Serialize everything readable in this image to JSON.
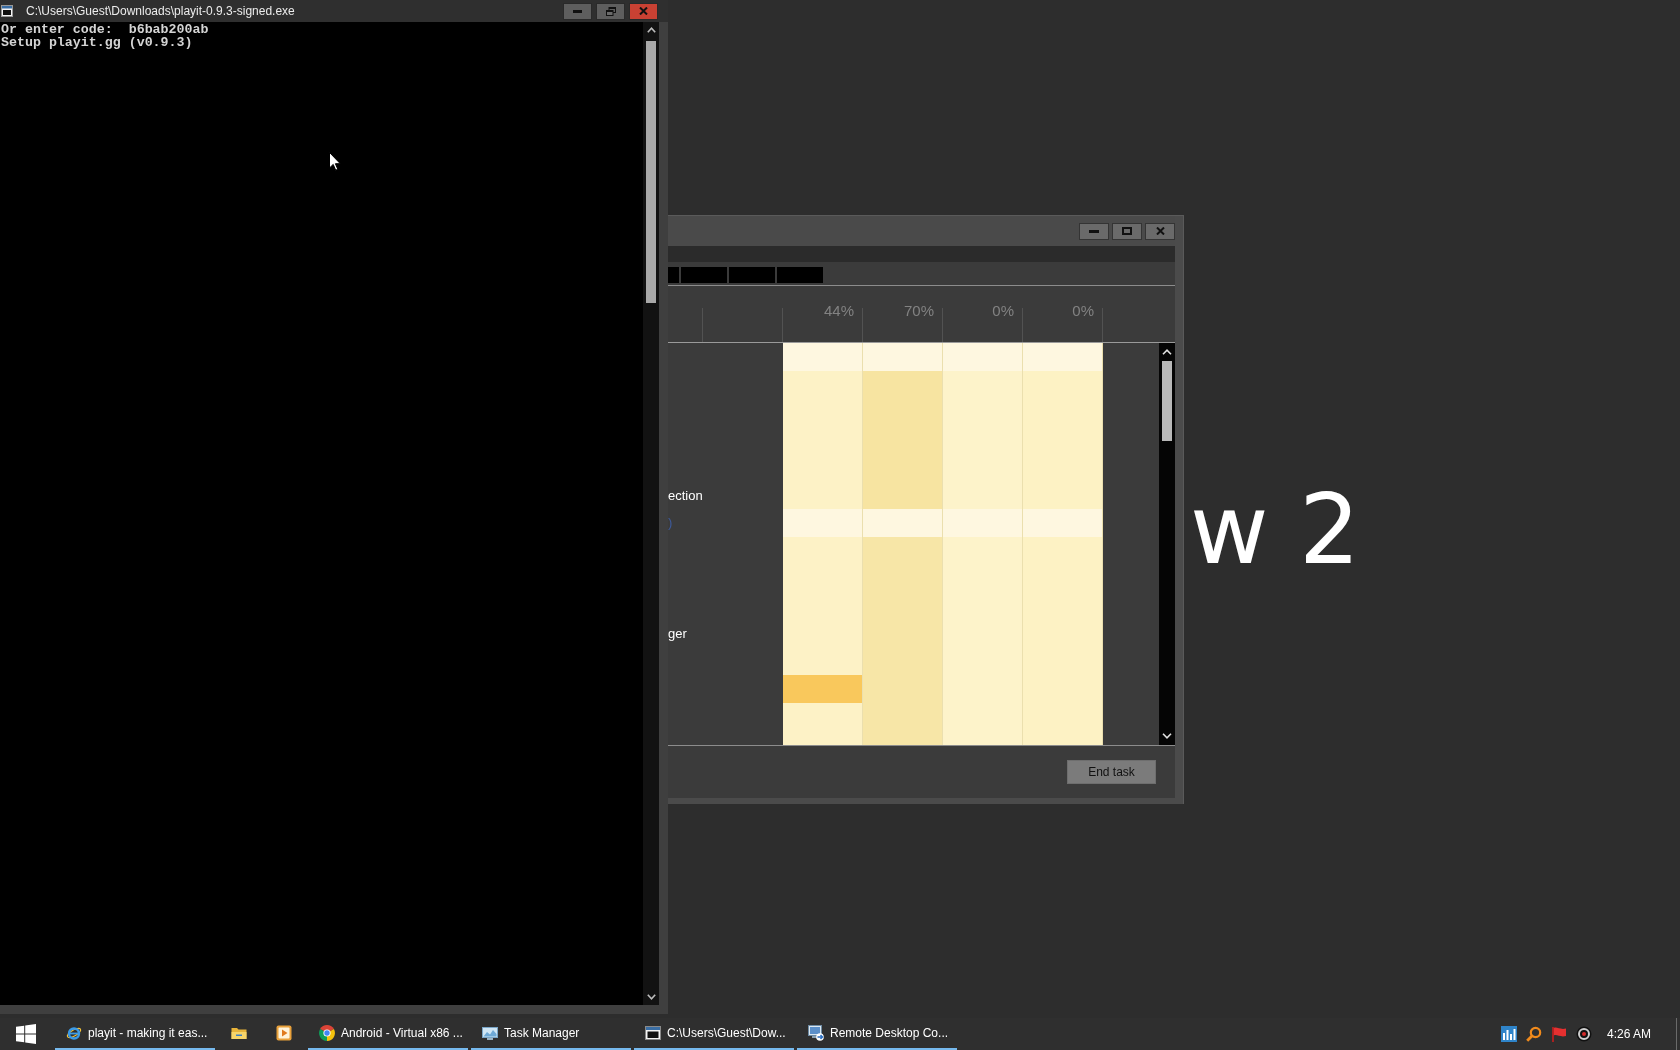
{
  "desktop": {
    "wallpaper_text": "w 2"
  },
  "console_window": {
    "title": "C:\\Users\\Guest\\Downloads\\playit-0.9.3-signed.exe",
    "lines": [
      "Or enter code:  b6bab200ab",
      "Setup playit.gg (v0.9.3)"
    ]
  },
  "task_manager": {
    "tabs": [
      {
        "kind": "cut"
      },
      {
        "kind": "full"
      },
      {
        "kind": "full"
      },
      {
        "kind": "full"
      }
    ],
    "columns": [
      {
        "heading": "44%"
      },
      {
        "heading": "70%"
      },
      {
        "heading": "0%"
      },
      {
        "heading": "0%"
      }
    ],
    "rows": [
      {
        "cells": [
          {
            "color": "#fef7e0"
          },
          {
            "color": "#fef7e0"
          },
          {
            "color": "#fef7e0"
          },
          {
            "color": "#fef7e0"
          }
        ]
      },
      {
        "cells": [
          {
            "color": "#fdf2c6"
          },
          {
            "color": "#f7e4a1"
          },
          {
            "color": "#fdf3ca"
          },
          {
            "color": "#fdf2c4"
          }
        ]
      },
      {
        "cells": [
          {
            "color": "#fdf2c6"
          },
          {
            "color": "#f7e4a1"
          },
          {
            "color": "#fdf3ca"
          },
          {
            "color": "#fdf2c4"
          }
        ]
      },
      {
        "cells": [
          {
            "color": "#fdf2c6"
          },
          {
            "color": "#f7e4a1"
          },
          {
            "color": "#fdf3ca"
          },
          {
            "color": "#fdf2c4"
          }
        ]
      },
      {
        "cells": [
          {
            "color": "#fdf2c6"
          },
          {
            "color": "#f7e4a1"
          },
          {
            "color": "#fdf3ca"
          },
          {
            "color": "#fdf2c4"
          }
        ]
      },
      {
        "label": "ection",
        "cells": [
          {
            "color": "#fdf2c6"
          },
          {
            "color": "#f7e4a1"
          },
          {
            "color": "#fdf3ca"
          },
          {
            "color": "#fdf2c4"
          }
        ]
      },
      {
        "count": ")",
        "cells": [
          {
            "color": "#fef7e0"
          },
          {
            "color": "#fef7e0"
          },
          {
            "color": "#fef7e0"
          },
          {
            "color": "#fef7e0"
          }
        ]
      },
      {
        "cells": [
          {
            "color": "#fdf2c6"
          },
          {
            "color": "#f7e6a7"
          },
          {
            "color": "#fdf3ca"
          },
          {
            "color": "#fdf2c4"
          }
        ]
      },
      {
        "cells": [
          {
            "color": "#fdf2c6"
          },
          {
            "color": "#f7e6a7"
          },
          {
            "color": "#fdf3ca"
          },
          {
            "color": "#fdf2c4"
          }
        ]
      },
      {
        "cells": [
          {
            "color": "#fdf2c6"
          },
          {
            "color": "#f7e6a7"
          },
          {
            "color": "#fdf3ca"
          },
          {
            "color": "#fdf2c4"
          }
        ]
      },
      {
        "label": "ger",
        "cells": [
          {
            "color": "#fdf2c6"
          },
          {
            "color": "#f7e6a7"
          },
          {
            "color": "#fdf3ca"
          },
          {
            "color": "#fdf2c4"
          }
        ]
      },
      {
        "cells": [
          {
            "color": "#fdf2c6"
          },
          {
            "color": "#f7e6a7"
          },
          {
            "color": "#fdf3ca"
          },
          {
            "color": "#fdf2c4"
          }
        ]
      },
      {
        "cells": [
          {
            "color": "#f9c85c"
          },
          {
            "color": "#f7e6a7"
          },
          {
            "color": "#fdf3ca"
          },
          {
            "color": "#fdf2c4"
          }
        ]
      },
      {
        "cells": [
          {
            "color": "#fdf2c6"
          },
          {
            "color": "#f7e6a7"
          },
          {
            "color": "#fdf3ca"
          },
          {
            "color": "#fdf2c4"
          }
        ]
      },
      {
        "cells": [
          {
            "color": "#fdf2c6"
          },
          {
            "color": "#f7e6a7"
          },
          {
            "color": "#fdf3ca"
          },
          {
            "color": "#fdf2c4"
          }
        ]
      }
    ],
    "button": "End task"
  },
  "taskbar": {
    "items": [
      {
        "kind": "ie",
        "label": "playit - making it eas...",
        "running": true
      },
      {
        "kind": "folder",
        "running": false
      },
      {
        "kind": "media",
        "running": false
      },
      {
        "kind": "chrome",
        "label": "Android - Virtual x86 ...",
        "running": true
      },
      {
        "kind": "taskmgr",
        "label": "Task Manager",
        "running": true
      },
      {
        "kind": "console",
        "label": "C:\\Users\\Guest\\Dow...",
        "running": true
      },
      {
        "kind": "rdp",
        "label": "Remote Desktop Co...",
        "running": true
      }
    ],
    "clock": "4:26 AM"
  }
}
